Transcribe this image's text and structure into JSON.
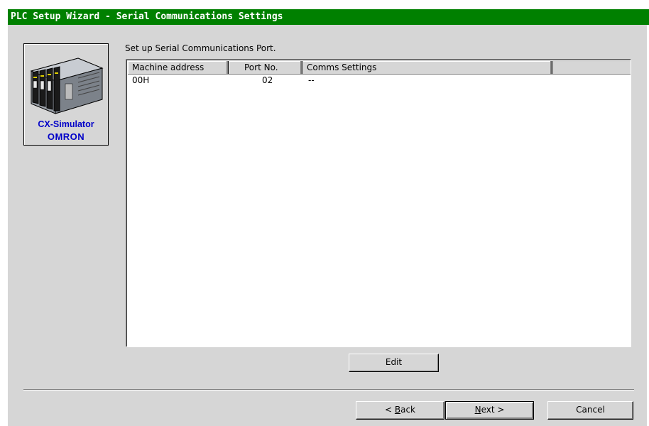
{
  "window": {
    "title": "PLC Setup Wizard - Serial Communications Settings"
  },
  "logo": {
    "line1": "CX-Simulator",
    "line2": "OMRON",
    "icon": "plc-rack-icon"
  },
  "instruction": "Set up Serial Communications Port.",
  "table": {
    "columns": [
      "Machine address",
      "Port No.",
      "Comms Settings"
    ],
    "rows": [
      {
        "machine_address": "00H",
        "port_no": "02",
        "comms_settings": "--"
      }
    ]
  },
  "buttons": {
    "edit": "Edit",
    "back_prefix": "< ",
    "back_hotkey": "B",
    "back_rest": "ack",
    "next_hotkey": "N",
    "next_rest": "ext >",
    "cancel": "Cancel"
  },
  "colors": {
    "titlebar": "#008000",
    "dialog_bg": "#d6d6d6",
    "brand_text": "#0000c8"
  }
}
